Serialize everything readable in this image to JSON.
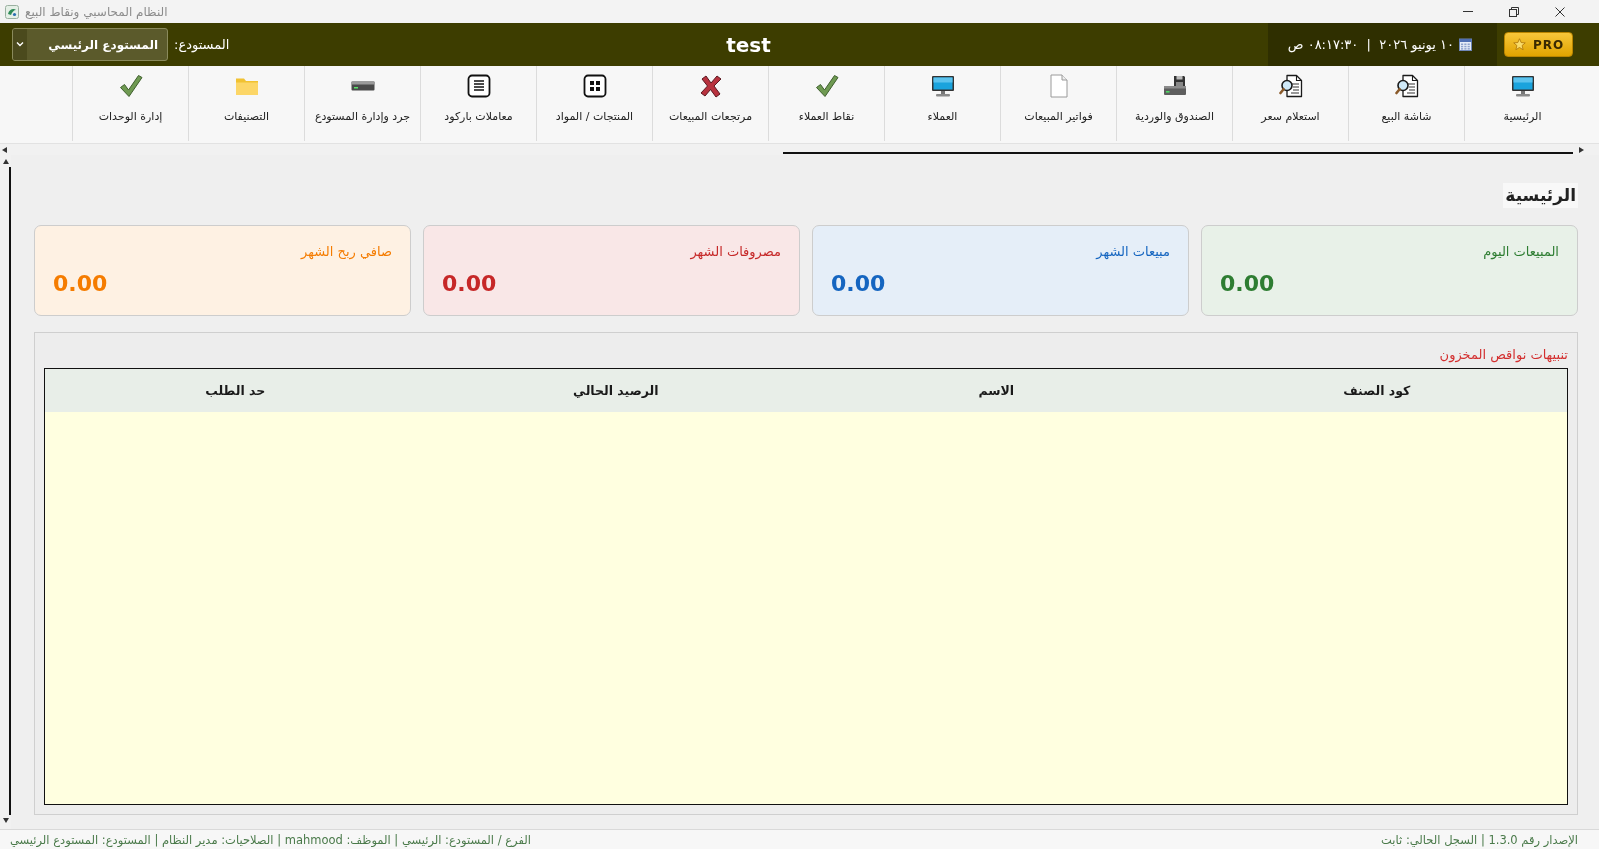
{
  "window": {
    "title": "النظام المحاسبي ونقاط البيع"
  },
  "header": {
    "pro_badge": "PRO",
    "datetime": "١٠ يونيو ٢٠٢٦  |  ٠٨:١٧:٣٠ ص",
    "company": "test",
    "warehouse_label": "المستودع:",
    "warehouse_select": {
      "value": "المستودع الرئيسي"
    }
  },
  "toolbar": {
    "items": [
      "الرئيسية",
      "شاشة البيع",
      "استعلام سعر",
      "الصندوق والوردية",
      "فواتير المبيعات",
      "العملاء",
      "نقاط العملاء",
      "مرتجعات المبيعات",
      "المنتجات / المواد",
      "معاملات باركود",
      "جرد وإدارة المستودع",
      "التصنيفات",
      "إدارة الوحدات"
    ]
  },
  "page": {
    "title": "الرئيسية"
  },
  "cards": [
    {
      "title": "المبيعات اليوم",
      "value": "0.00",
      "color": "#2e7d32"
    },
    {
      "title": "مبيعات الشهر",
      "value": "0.00",
      "color": "#1565c0"
    },
    {
      "title": "مصروفات الشهر",
      "value": "0.00",
      "color": "#c62828"
    },
    {
      "title": "صافي ربح الشهر",
      "value": "0.00",
      "color": "#f57c00"
    }
  ],
  "stock_alerts": {
    "title": "تنبيهات نواقص المخزون",
    "table": {
      "columns": [
        "كود الصنف",
        "الاسم",
        "الرصيد الحالي",
        "حد الطلب"
      ]
    }
  },
  "status_bar": {
    "items": [
      "الإصدار رقم 1.3.0 | السجل الحالي: ثابت",
      "الفرع / المستودع: الرئيسي | الموظف: mahmood | الصلاحيات: مدير النظام | المستودع: المستودع الرئيسي"
    ]
  }
}
